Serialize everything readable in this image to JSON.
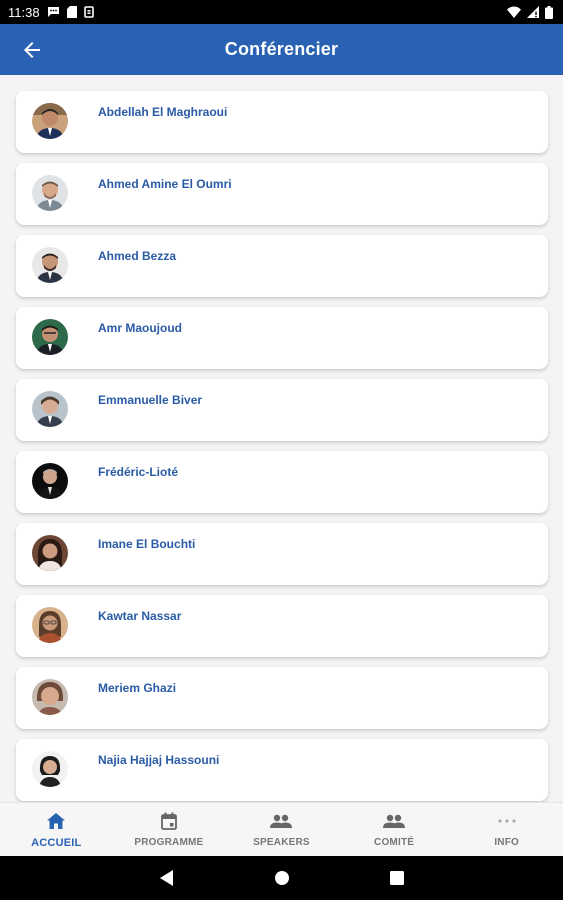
{
  "status_bar": {
    "time": "11:38",
    "left_icons": [
      "chat-bubble-icon",
      "sim-card-icon",
      "shield-icon"
    ],
    "right_icons": [
      "wifi-icon",
      "signal-icon",
      "battery-icon"
    ]
  },
  "app_bar": {
    "back_icon": "arrow-back-icon",
    "title": "Conférencier"
  },
  "speakers": [
    {
      "name": "Abdellah El Maghraoui"
    },
    {
      "name": "Ahmed Amine El Oumri"
    },
    {
      "name": "Ahmed Bezza"
    },
    {
      "name": "Amr Maoujoud"
    },
    {
      "name": "Emmanuelle Biver"
    },
    {
      "name": "Frédéric-Lioté"
    },
    {
      "name": "Imane El Bouchti"
    },
    {
      "name": "Kawtar Nassar"
    },
    {
      "name": "Meriem Ghazi"
    },
    {
      "name": "Najia Hajjaj Hassouni"
    }
  ],
  "bottom_nav": {
    "active": "ACCUEIL",
    "items": [
      {
        "label": "ACCUEIL",
        "icon": "home-icon"
      },
      {
        "label": "PROGRAMME",
        "icon": "calendar-icon"
      },
      {
        "label": "SPEAKERS",
        "icon": "people-icon"
      },
      {
        "label": "COMITÉ",
        "icon": "people-icon"
      },
      {
        "label": "INFO",
        "icon": "more-horizontal-icon"
      }
    ]
  },
  "system_nav": {
    "icons": [
      "back-triangle-icon",
      "home-circle-icon",
      "recents-square-icon"
    ]
  },
  "colors": {
    "primary": "#2a62b3",
    "name_text": "#2a5ba6",
    "background": "#f4f4f6",
    "nav_inactive": "#777777"
  }
}
